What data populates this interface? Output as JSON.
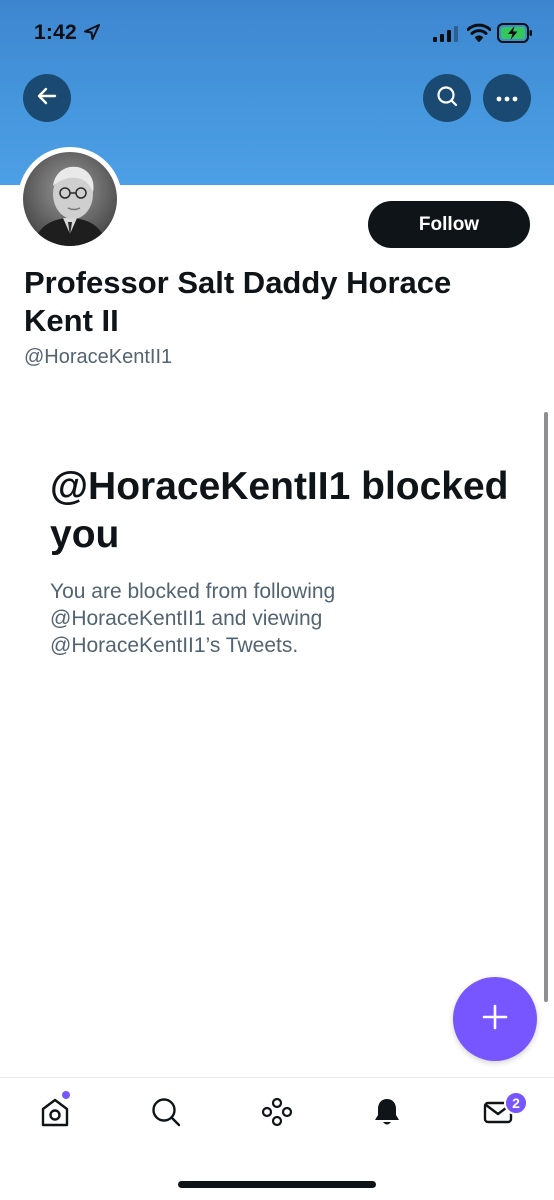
{
  "status_bar": {
    "time": "1:42",
    "icons": [
      "location-arrow-icon",
      "cellular-signal-icon",
      "wifi-icon",
      "battery-charging-icon"
    ]
  },
  "header": {
    "back_icon": "arrow-left-icon",
    "search_icon": "search-icon",
    "more_icon": "ellipsis-icon",
    "banner_color": "#4596dc"
  },
  "profile": {
    "display_name": "Professor Salt Daddy Horace Kent II",
    "handle": "@HoraceKentII1",
    "follow_label": "Follow"
  },
  "blocked": {
    "title": "@HoraceKentII1 blocked you",
    "description": "You are blocked from following @HoraceKentII1 and viewing @HoraceKentII1’s Tweets."
  },
  "fab": {
    "icon": "plus-icon",
    "color": "#7856ff"
  },
  "tab_bar": {
    "items": [
      "home-icon",
      "search-icon",
      "spaces-icon",
      "notifications-icon",
      "messages-icon"
    ],
    "messages_badge": "2",
    "accent": "#7856ff"
  }
}
